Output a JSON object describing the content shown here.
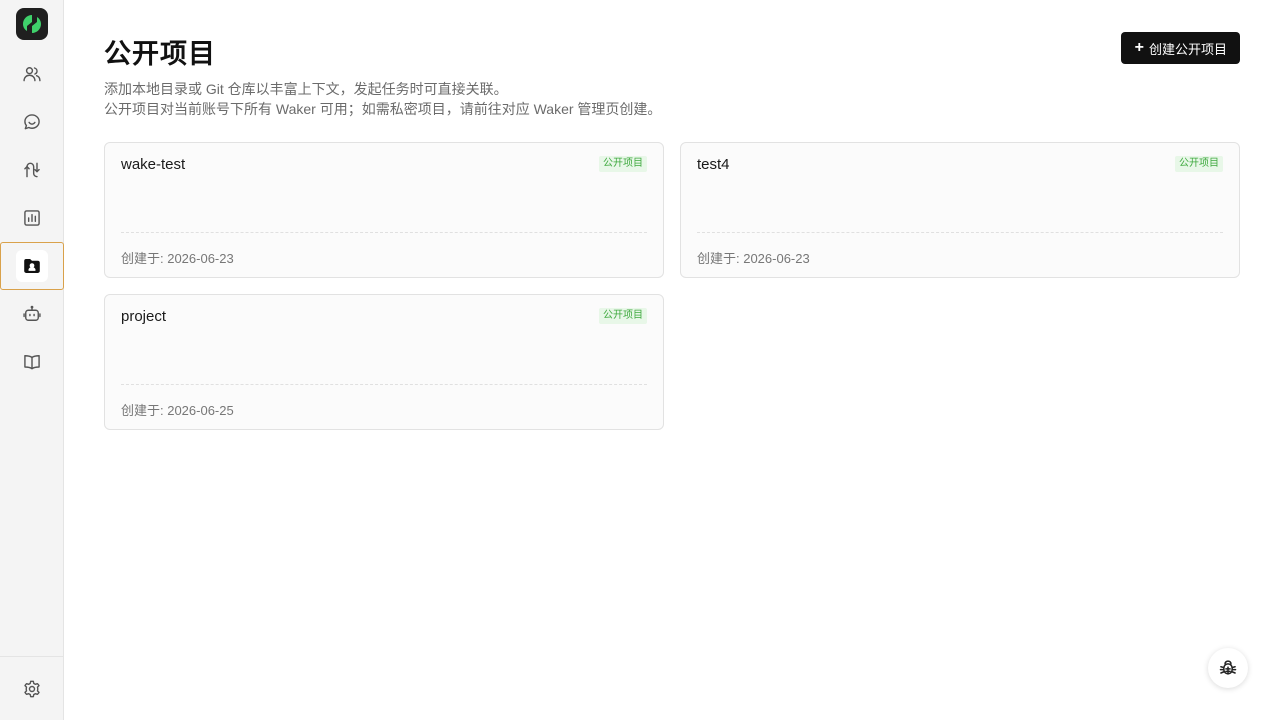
{
  "sidebar": {
    "logo": "app-logo",
    "items": [
      {
        "name": "users",
        "icon": "users-icon"
      },
      {
        "name": "chat",
        "icon": "chat-icon"
      },
      {
        "name": "workflow",
        "icon": "route-icon"
      },
      {
        "name": "analytics",
        "icon": "bar-chart-icon"
      },
      {
        "name": "public-projects",
        "icon": "folder-user-icon",
        "active": true
      },
      {
        "name": "bots",
        "icon": "robot-icon"
      },
      {
        "name": "docs",
        "icon": "book-icon"
      }
    ],
    "settings_icon": "gear-icon"
  },
  "header": {
    "title": "公开项目",
    "description_line1": "添加本地目录或 Git 仓库以丰富上下文，发起任务时可直接关联。",
    "description_line2": "公开项目对当前账号下所有 Waker 可用；如需私密项目，请前往对应 Waker 管理页创建。",
    "create_button": "创建公开项目"
  },
  "projects": [
    {
      "name": "wake-test",
      "badge": "公开项目",
      "created": "创建于: 2026-06-23"
    },
    {
      "name": "test4",
      "badge": "公开项目",
      "created": "创建于: 2026-06-23"
    },
    {
      "name": "project",
      "badge": "公开项目",
      "created": "创建于: 2026-06-25"
    }
  ],
  "floating": {
    "icon": "bug-icon"
  },
  "colors": {
    "accent_active_border": "#d9a14a",
    "badge_bg": "#e8f7e8",
    "badge_text": "#3faa3f",
    "primary_button": "#111111",
    "logo_green": "#3fd16b"
  }
}
